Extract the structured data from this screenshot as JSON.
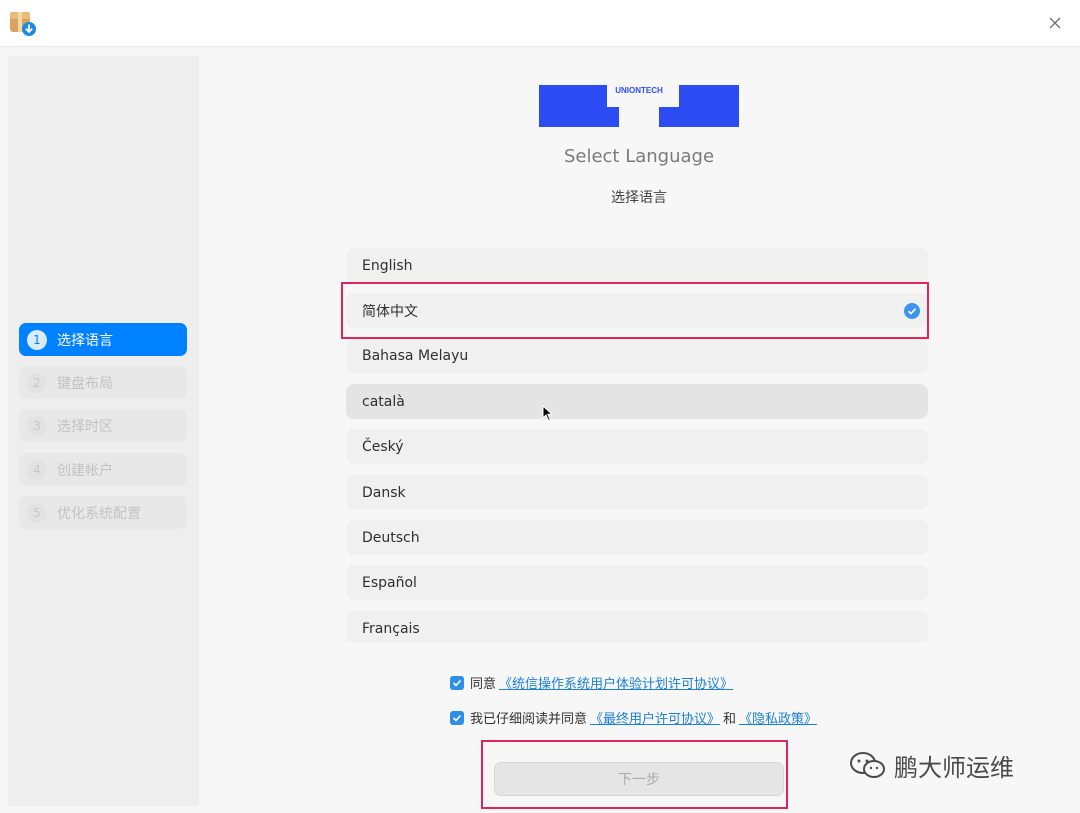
{
  "titlebar": {
    "app_icon": "installer-package-icon",
    "close_icon": "close-icon"
  },
  "sidebar": {
    "steps": [
      {
        "num": "1",
        "label": "选择语言",
        "active": true
      },
      {
        "num": "2",
        "label": "键盘布局",
        "active": false
      },
      {
        "num": "3",
        "label": "选择时区",
        "active": false
      },
      {
        "num": "4",
        "label": "创建帐户",
        "active": false
      },
      {
        "num": "5",
        "label": "优化系统配置",
        "active": false
      }
    ]
  },
  "main": {
    "logo_text": "UNIONTECH",
    "title": "Select Language",
    "subtitle": "选择语言",
    "languages": [
      "English",
      "简体中文",
      "Bahasa Melayu",
      "català",
      "Český",
      "Dansk",
      "Deutsch",
      "Español",
      "Français"
    ],
    "selected_language": "简体中文",
    "hovered_language": "català"
  },
  "agreements": {
    "row1": {
      "prefix": "同意",
      "link": "《统信操作系统用户体验计划许可协议》",
      "checked": true
    },
    "row2": {
      "prefix": "我已仔细阅读并同意",
      "link1": "《最终用户许可协议》",
      "joiner": "和",
      "link2": "《隐私政策》",
      "checked": true
    }
  },
  "next_button": {
    "label": "下一步",
    "enabled": false
  },
  "watermark": {
    "text": "鹏大师运维",
    "icon": "wechat-icon"
  },
  "colors": {
    "accent": "#0081ff",
    "highlight": "#e0245e",
    "link": "#1a7fd8",
    "logo": "#2b4cf2"
  }
}
